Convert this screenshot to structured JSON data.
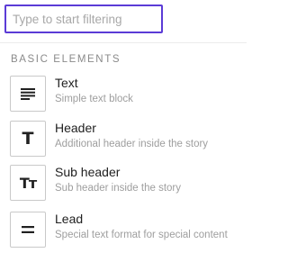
{
  "search": {
    "placeholder": "Type to start filtering",
    "value": ""
  },
  "section": {
    "title": "BASIC ELEMENTS"
  },
  "items": [
    {
      "title": "Text",
      "description": "Simple text block",
      "icon": "text-lines-icon"
    },
    {
      "title": "Header",
      "description": "Additional header inside the story",
      "icon": "header-t-icon",
      "glyph": "T"
    },
    {
      "title": "Sub header",
      "description": "Sub header inside the story",
      "icon": "subheader-tt-icon",
      "glyph": "Tт"
    },
    {
      "title": "Lead",
      "description": "Special text format for special content",
      "icon": "lead-equals-icon"
    }
  ],
  "colors": {
    "focus_border": "#5b3bd6",
    "muted_text": "#9e9e9e",
    "section_text": "#8a8a8a"
  }
}
